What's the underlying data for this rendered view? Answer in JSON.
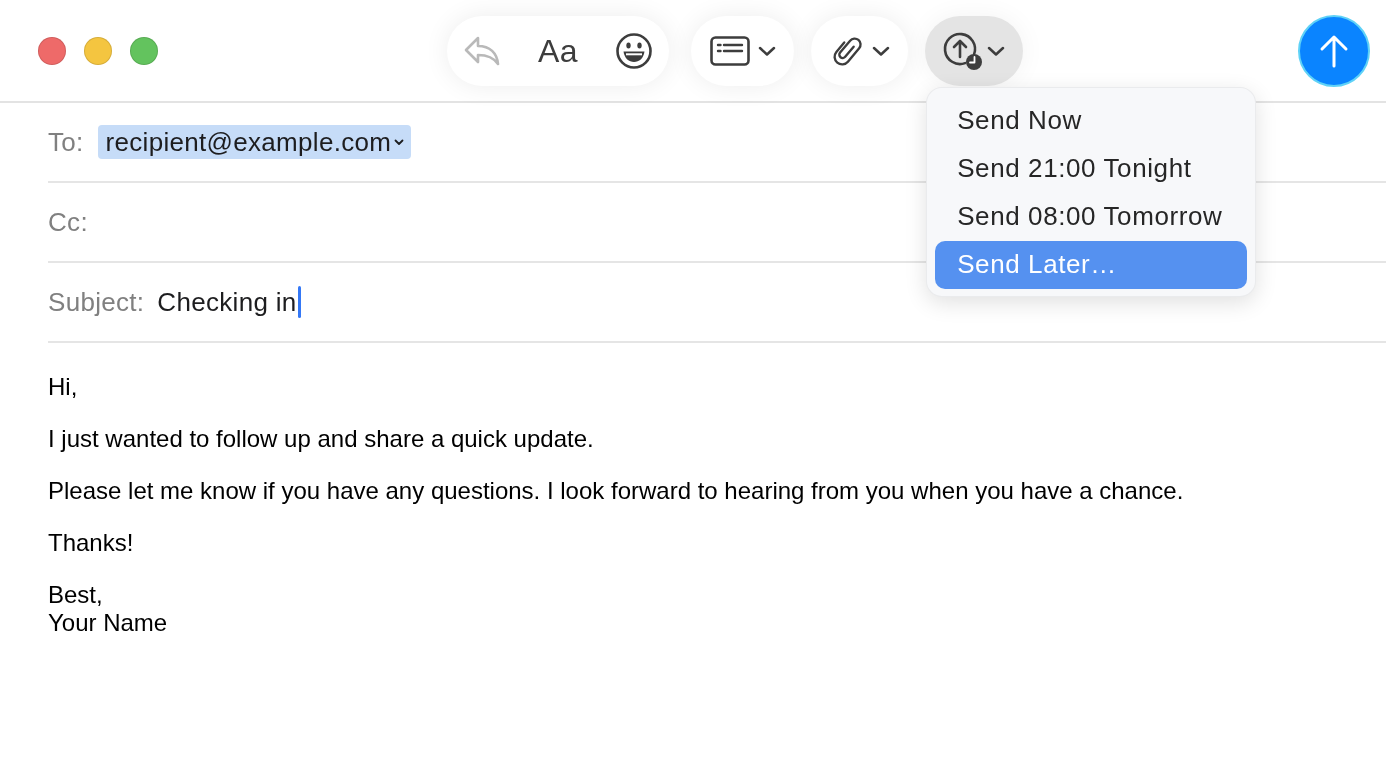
{
  "window_controls": [
    {
      "color": "#ee6a69"
    },
    {
      "color": "#f4c540"
    },
    {
      "color": "#63c35e"
    }
  ],
  "toolbar": {
    "format_group": [
      {
        "kind": "reply",
        "disabled": true
      },
      {
        "kind": "format",
        "label": "Aa",
        "disabled": false
      },
      {
        "kind": "emoji",
        "disabled": false
      }
    ],
    "menu_buttons": [
      {
        "kind": "header_fields",
        "expanded": false
      },
      {
        "kind": "attachment",
        "expanded": false
      },
      {
        "kind": "send_later",
        "expanded": true,
        "menu_items": [
          {
            "label": "Send Now",
            "selected": false
          },
          {
            "label": "Send 21:00 Tonight",
            "selected": false
          },
          {
            "label": "Send 08:00 Tomorrow",
            "selected": false
          },
          {
            "label": "Send Later…",
            "selected": true
          }
        ]
      }
    ],
    "send_button": {
      "disabled": false
    }
  },
  "fields": [
    {
      "kind": "recipients",
      "label": "To:",
      "tokens": [
        "recipient@example.com"
      ]
    },
    {
      "kind": "recipients",
      "label": "Cc:"
    },
    {
      "kind": "text",
      "label": "Subject:",
      "value": "Checking in",
      "focused": true
    }
  ],
  "body": {
    "paragraphs": [
      "Hi,",
      "I just wanted to follow up and share a quick update.",
      "Please let me know if you have any questions. I look forward to hearing from you when you have a chance.",
      "Thanks!",
      "Best,\nYour Name"
    ]
  }
}
